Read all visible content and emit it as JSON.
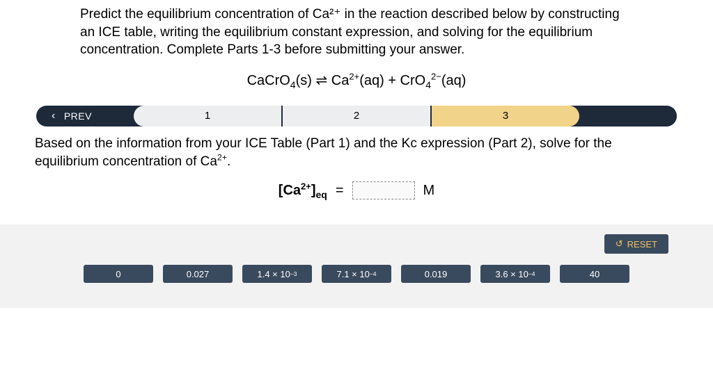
{
  "prompt": "Predict the equilibrium concentration of Ca²⁺ in the reaction described below by constructing an ICE table, writing the equilibrium constant expression, and solving for the equilibrium concentration. Complete Parts 1-3 before submitting your answer.",
  "equation_html": "CaCrO<sub>4</sub>(s) ⇌ Ca<sup>2+</sup>(aq) + CrO<sub>4</sub><sup>2−</sup>(aq)",
  "nav": {
    "prev": "PREV",
    "steps": [
      "1",
      "2",
      "3"
    ],
    "active_index": 2
  },
  "instruction_html": "Based on the information from your ICE Table (Part 1) and the  Kc expression (Part 2), solve for the equilibrium concentration of Ca<sup>2+</sup>.",
  "answer": {
    "lhs_html": "[Ca<sup>2+</sup>]<sub>eq</sub>",
    "equals": "=",
    "unit": "M"
  },
  "reset_label": "RESET",
  "options": [
    {
      "label_html": "0"
    },
    {
      "label_html": "0.027"
    },
    {
      "label_html": "1.4 × 10<sup>−3</sup>"
    },
    {
      "label_html": "7.1 × 10<sup>−4</sup>"
    },
    {
      "label_html": "0.019"
    },
    {
      "label_html": "3.6 × 10<sup>−4</sup>"
    },
    {
      "label_html": "40"
    }
  ]
}
